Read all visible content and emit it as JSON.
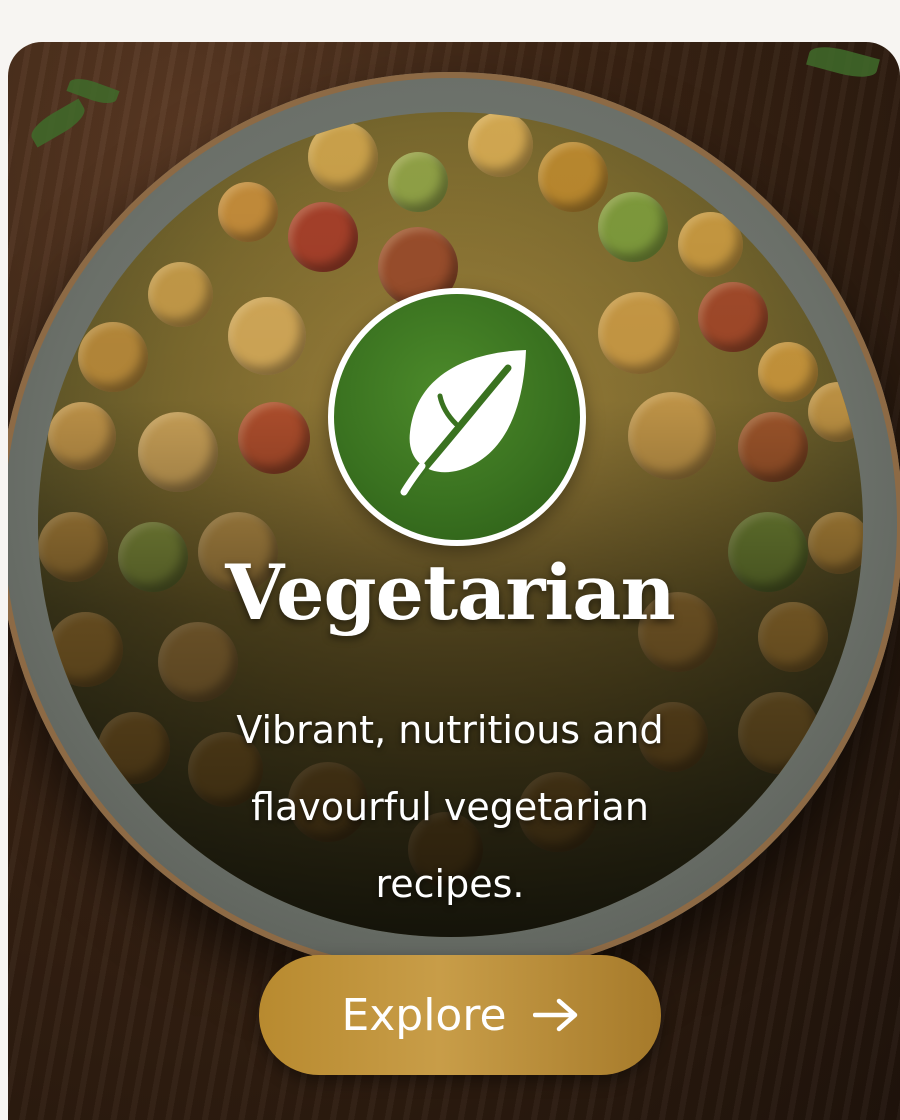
{
  "card": {
    "title": "Vegetarian",
    "description": "Vibrant, nutritious and flavourful vegetarian recipes.",
    "button_label": "Explore",
    "badge_icon": "leaf-icon",
    "button_icon": "arrow-right-icon"
  },
  "colors": {
    "badge_green": "#3a7220",
    "button_gold": "#c89d48",
    "text": "#ffffff"
  }
}
